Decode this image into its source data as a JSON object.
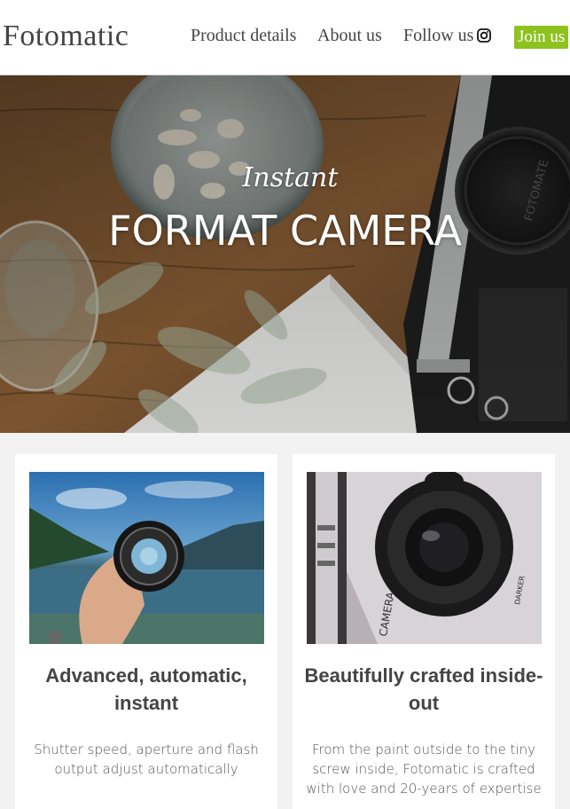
{
  "header": {
    "brand": "Fotomatic",
    "nav": {
      "product_details": "Product details",
      "about_us": "About us",
      "follow_us": "Follow us",
      "follow_icon": "instagram-icon"
    },
    "join_button": "Join us",
    "join_color": "#8dc21f"
  },
  "hero": {
    "script_text": "Instant",
    "title": "FORMAT CAMERA"
  },
  "features": [
    {
      "title": "Advanced, automatic, instant",
      "text": "Shutter speed, aperture and flash output adjust automatically"
    },
    {
      "title": "Beautifully crafted inside-out",
      "text": "From the paint outside to the tiny screw inside, Fotomatic is crafted with love and 20-years of expertise"
    }
  ]
}
